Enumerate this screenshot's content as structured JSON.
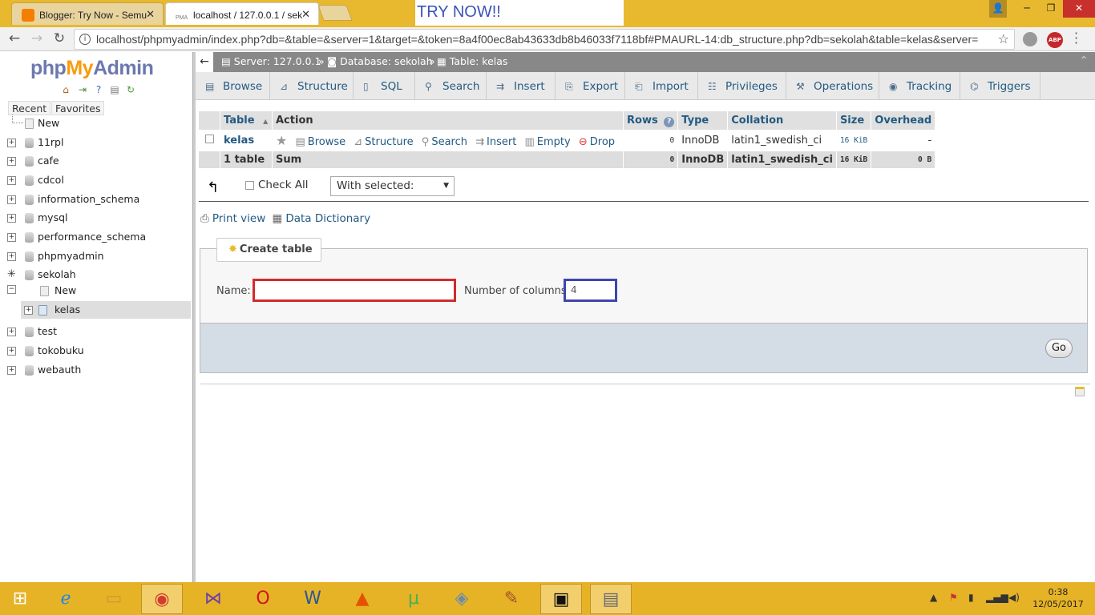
{
  "browser": {
    "tabs": [
      {
        "title": "Blogger: Try Now - Semu"
      },
      {
        "title": "localhost / 127.0.0.1 / sek",
        "favicon": "PMA"
      }
    ],
    "overlay_text": "TRY NOW!!",
    "url": "localhost/phpmyadmin/index.php?db=&table=&server=1&target=&token=8a4f00ec8ab43633db8b46033f7118bf#PMAURL-14:db_structure.php?db=sekolah&table=kelas&server=",
    "abp_label": "ABP"
  },
  "sidebar": {
    "logo": {
      "php": "php",
      "my": "My",
      "admin": "Admin"
    },
    "tabs": [
      "Recent",
      "Favorites"
    ],
    "items": [
      {
        "label": "New"
      },
      {
        "label": "11rpl"
      },
      {
        "label": "cafe"
      },
      {
        "label": "cdcol"
      },
      {
        "label": "information_schema"
      },
      {
        "label": "mysql"
      },
      {
        "label": "performance_schema"
      },
      {
        "label": "phpmyadmin"
      },
      {
        "label": "sekolah"
      },
      {
        "label": "New"
      },
      {
        "label": "kelas"
      },
      {
        "label": "test"
      },
      {
        "label": "tokobuku"
      },
      {
        "label": "webauth"
      }
    ]
  },
  "breadcrumb": {
    "server": "Server: 127.0.0.1",
    "database": "Database: sekolah",
    "table": "Table: kelas",
    "sep": "»"
  },
  "tabs": [
    {
      "label": "Browse",
      "icon": "browse-icon"
    },
    {
      "label": "Structure",
      "icon": "structure-icon"
    },
    {
      "label": "SQL",
      "icon": "sql-icon"
    },
    {
      "label": "Search",
      "icon": "search-icon"
    },
    {
      "label": "Insert",
      "icon": "insert-icon"
    },
    {
      "label": "Export",
      "icon": "export-icon"
    },
    {
      "label": "Import",
      "icon": "import-icon"
    },
    {
      "label": "Privileges",
      "icon": "privileges-icon"
    },
    {
      "label": "Operations",
      "icon": "operations-icon"
    },
    {
      "label": "Tracking",
      "icon": "tracking-icon"
    },
    {
      "label": "Triggers",
      "icon": "triggers-icon"
    }
  ],
  "table": {
    "headers": [
      "Table",
      "Action",
      "Rows",
      "Type",
      "Collation",
      "Size",
      "Overhead"
    ],
    "row": {
      "name": "kelas",
      "actions": [
        "Browse",
        "Structure",
        "Search",
        "Insert",
        "Empty",
        "Drop"
      ],
      "rows": "0",
      "type": "InnoDB",
      "collation": "latin1_swedish_ci",
      "size": "16 KiB",
      "overhead": "-"
    },
    "footer": {
      "name": "1 table",
      "action": "Sum",
      "rows": "0",
      "type": "InnoDB",
      "collation": "latin1_swedish_ci",
      "size": "16 KiB",
      "overhead": "0 B"
    }
  },
  "with_selected": {
    "check_all": "Check All",
    "select_value": "With selected:"
  },
  "links": {
    "print_view": "Print view",
    "data_dictionary": "Data Dictionary"
  },
  "create_table": {
    "legend": "Create table",
    "name_label": "Name:",
    "name_value": "",
    "columns_label": "Number of columns:",
    "columns_value": "4",
    "go": "Go"
  },
  "taskbar": {
    "clock_time": "0:38",
    "clock_date": "12/05/2017"
  },
  "colors": {
    "titlebar": "#e8b92e",
    "taskbar": "#e6b326",
    "link": "#235a81",
    "name_border": "#d22b2b",
    "cols_border": "#3e46ad"
  }
}
